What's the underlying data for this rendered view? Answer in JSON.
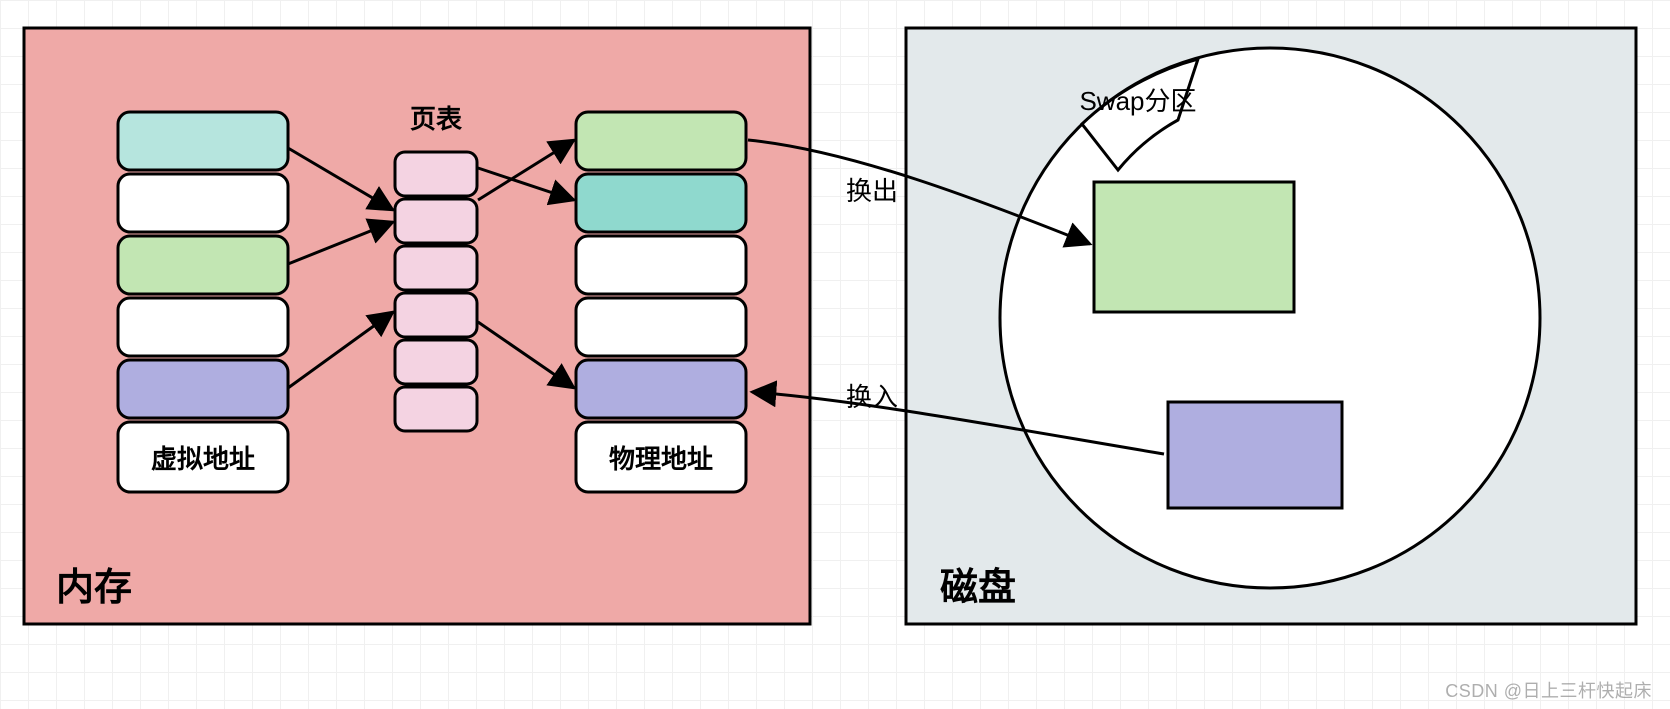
{
  "memory": {
    "title": "内存",
    "page_table_label": "页表",
    "virtual_label": "虚拟地址",
    "physical_label": "物理地址"
  },
  "disk": {
    "title": "磁盘",
    "swap_label": "Swap分区"
  },
  "swap": {
    "out_label": "换出",
    "in_label": "换入"
  },
  "watermark": "CSDN @日上三杆快起床",
  "colors": {
    "memory_bg": "#EFA9A7",
    "disk_bg": "#E3E9EB",
    "teal": "#B6E5DE",
    "teal2": "#8FD9CE",
    "green": "#C2E6B3",
    "purple": "#AFAEE0",
    "pink": "#F4D3E2",
    "white": "#FFFFFF",
    "stroke": "#000000"
  }
}
